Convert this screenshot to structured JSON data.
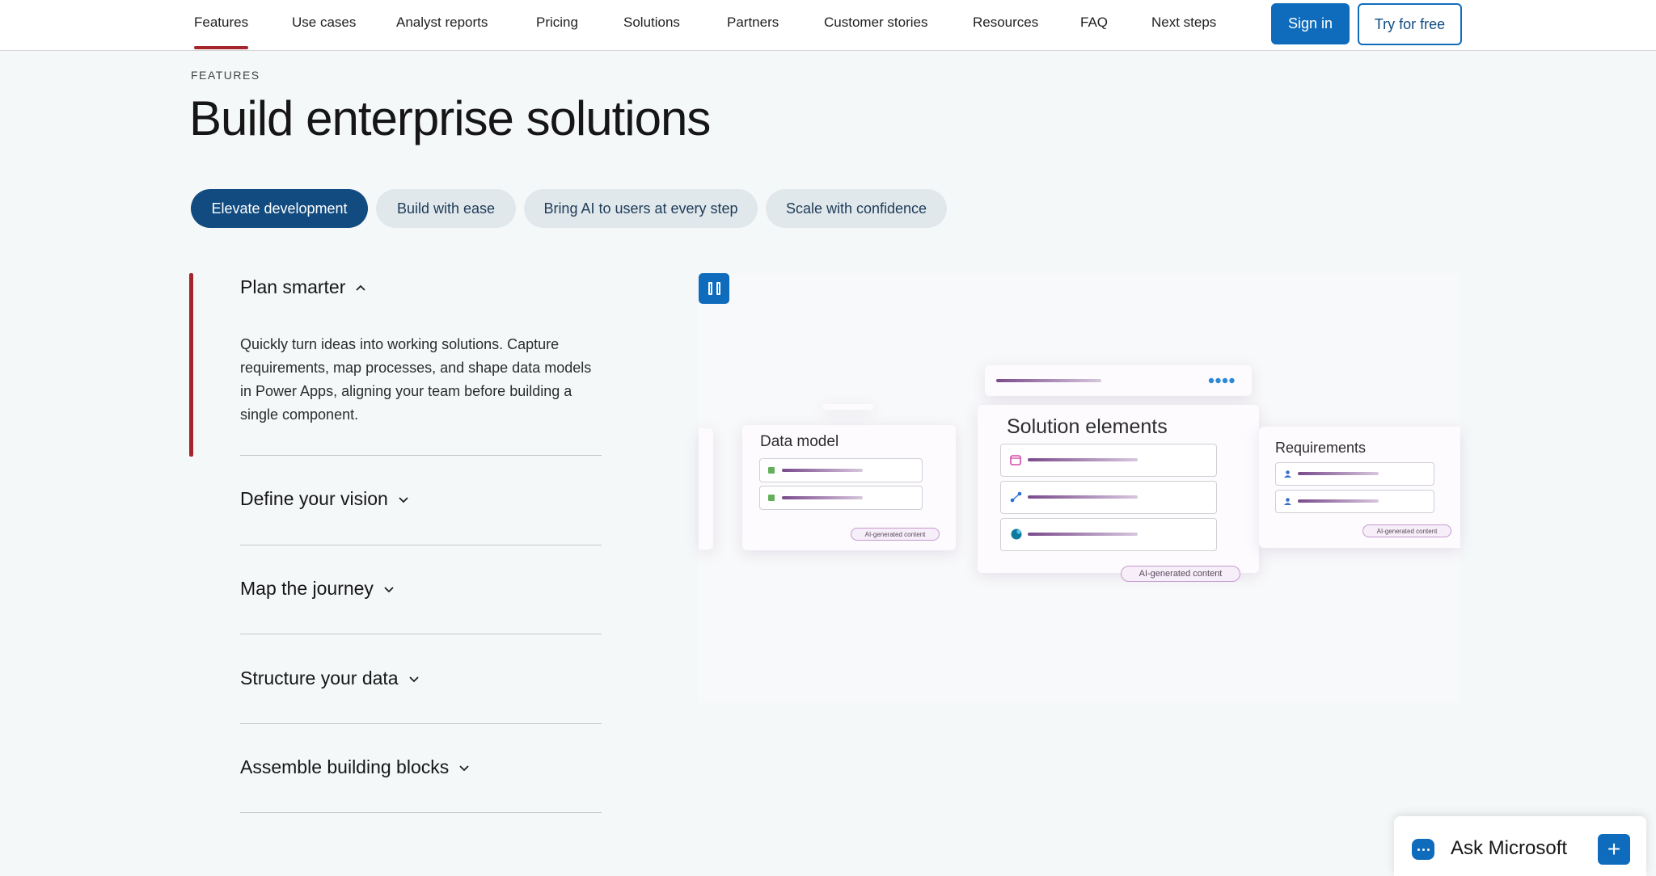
{
  "nav": {
    "links": [
      "Features",
      "Use cases",
      "Analyst reports",
      "Pricing",
      "Solutions",
      "Partners",
      "Customer stories",
      "Resources",
      "FAQ",
      "Next steps"
    ],
    "active": "Features",
    "sign_in": "Sign in",
    "try_free": "Try for free"
  },
  "header": {
    "eyebrow": "FEATURES",
    "title": "Build enterprise solutions"
  },
  "tabs": [
    "Elevate development",
    "Build with ease",
    "Bring AI to users at every step",
    "Scale with confidence"
  ],
  "active_tab": "Elevate development",
  "accordion": {
    "items": [
      {
        "label": "Plan smarter",
        "expanded": true,
        "body": "Quickly turn ideas into working solutions. Capture requirements, map processes, and shape data models in Power Apps, aligning your team before building a single component."
      },
      {
        "label": "Define your vision",
        "expanded": false
      },
      {
        "label": "Map the journey",
        "expanded": false
      },
      {
        "label": "Structure your data",
        "expanded": false
      },
      {
        "label": "Assemble building blocks",
        "expanded": false
      }
    ]
  },
  "media": {
    "pause_icon": "pause-icon",
    "cards": {
      "data_model": "Data model",
      "solution_elements": "Solution elements",
      "requirements": "Requirements"
    },
    "ai_badge": "AI-generated content"
  },
  "ask": {
    "label": "Ask Microsoft",
    "plus": "+"
  },
  "colors": {
    "accent": "#0f6cbd",
    "active_pill": "#114b7f",
    "indicator": "#a4262c"
  }
}
